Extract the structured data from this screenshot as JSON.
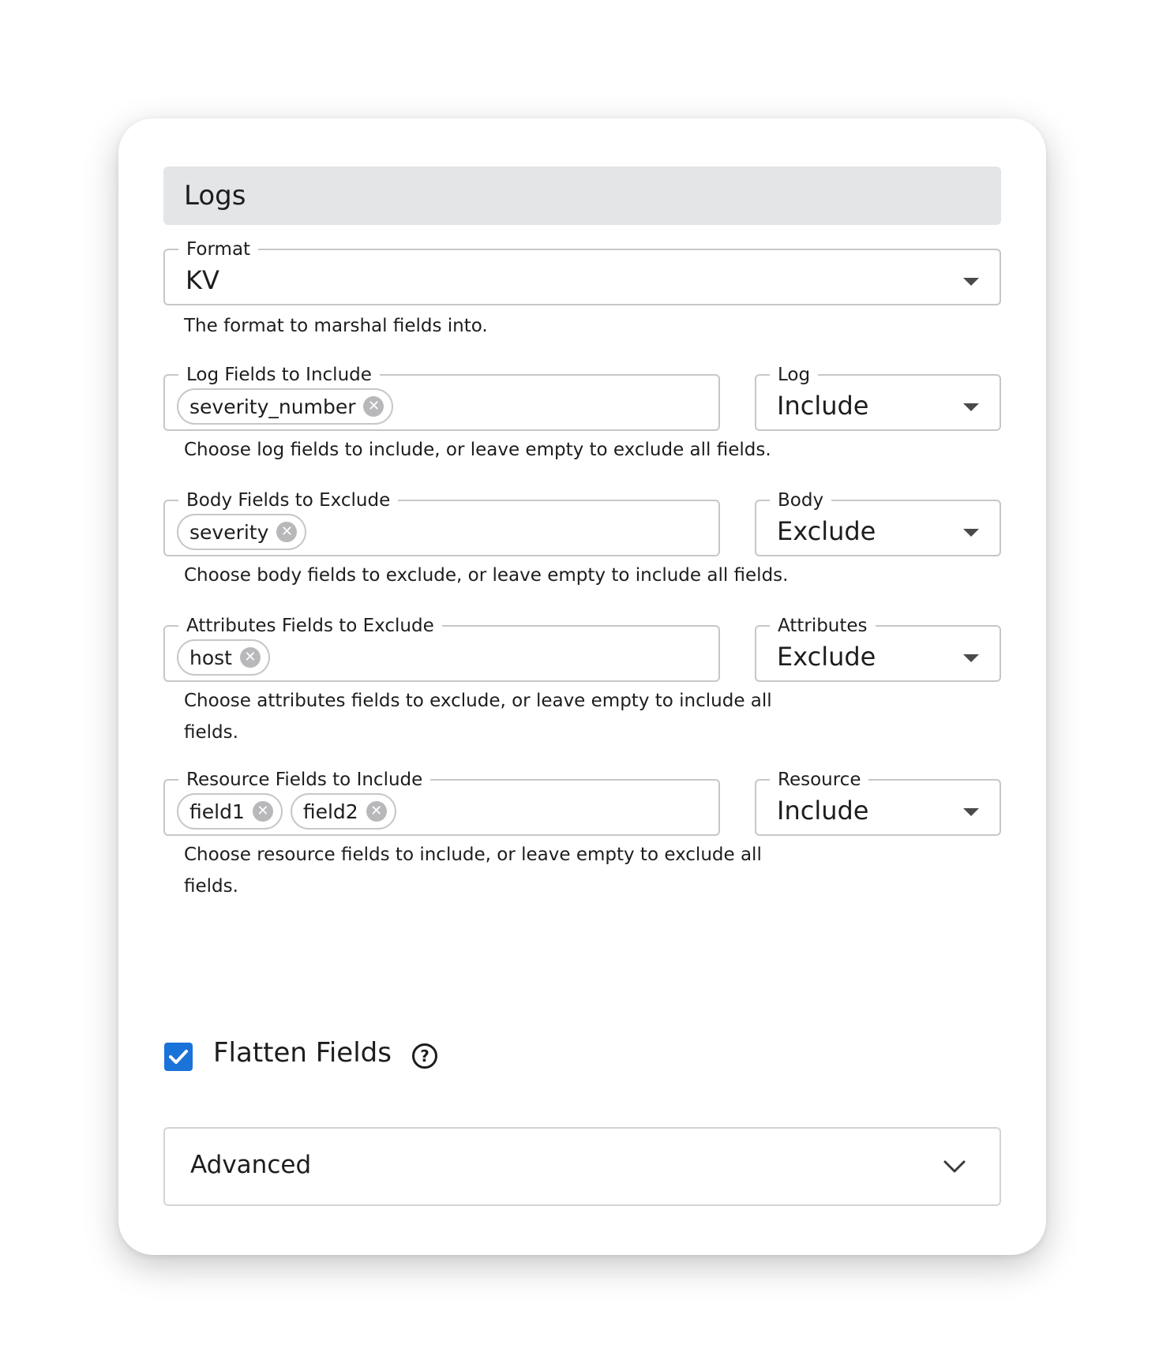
{
  "section": {
    "title": "Logs"
  },
  "format": {
    "label": "Format",
    "value": "KV",
    "helper": "The format to marshal fields into."
  },
  "log_fields": {
    "label": "Log Fields to Include",
    "chips": [
      "severity_number"
    ],
    "mode_label": "Log",
    "mode_value": "Include",
    "helper": "Choose log fields to include, or leave empty to exclude all fields."
  },
  "body_fields": {
    "label": "Body Fields to Exclude",
    "chips": [
      "severity"
    ],
    "mode_label": "Body",
    "mode_value": "Exclude",
    "helper": "Choose body fields to exclude, or leave empty to include all fields."
  },
  "attributes_fields": {
    "label": "Attributes Fields to Exclude",
    "chips": [
      "host"
    ],
    "mode_label": "Attributes",
    "mode_value": "Exclude",
    "helper_line1": "Choose attributes fields to exclude, or leave empty to include all",
    "helper_line2": "fields."
  },
  "resource_fields": {
    "label": "Resource Fields to Include",
    "chips": [
      "field1",
      "field2"
    ],
    "mode_label": "Resource",
    "mode_value": "Include",
    "helper_line1": "Choose resource fields to include, or leave empty to exclude all",
    "helper_line2": "fields."
  },
  "flatten": {
    "label": "Flatten Fields",
    "checked": true,
    "help_glyph": "?"
  },
  "advanced": {
    "label": "Advanced"
  },
  "colors": {
    "accent": "#1a73d9",
    "header_bg": "#e4e5e7",
    "border": "#c7c7c9"
  },
  "icons": {
    "chip_remove": "close-circle-icon",
    "select": "caret-down-icon",
    "accordion": "chevron-down-icon"
  }
}
